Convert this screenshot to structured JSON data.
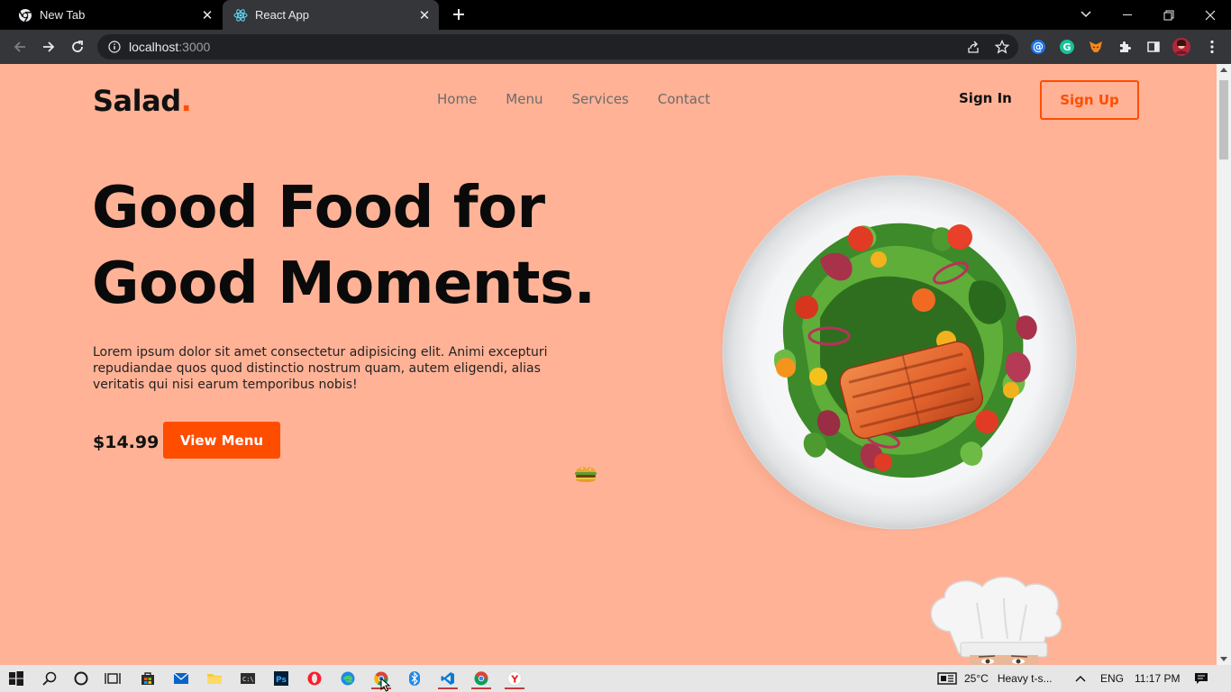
{
  "browser": {
    "tabs": [
      {
        "label": "New Tab",
        "active": false
      },
      {
        "label": "React App",
        "active": true
      }
    ],
    "url_host": "localhost",
    "url_port": ":3000"
  },
  "site": {
    "logo": "Salad",
    "logo_dot": ".",
    "nav": [
      "Home",
      "Menu",
      "Services",
      "Contact"
    ],
    "sign_in": "Sign In",
    "sign_up": "Sign Up",
    "hero_line1": "Good Food for",
    "hero_line2": "Good Moments.",
    "hero_text": "Lorem ipsum dolor sit amet consectetur adipisicing elit. Animi excepturi repudiandae quos quod distinctio nostrum quam, autem eligendi, alias veritatis qui nisi earum temporibus nobis!",
    "price": "$14.99",
    "view_menu": "View Menu",
    "accent_color": "#ff4d00",
    "background_color": "#ffb296"
  },
  "taskbar": {
    "weather": "25°C",
    "weather_desc": "Heavy t-s...",
    "language": "ENG",
    "time": "11:17 PM"
  }
}
